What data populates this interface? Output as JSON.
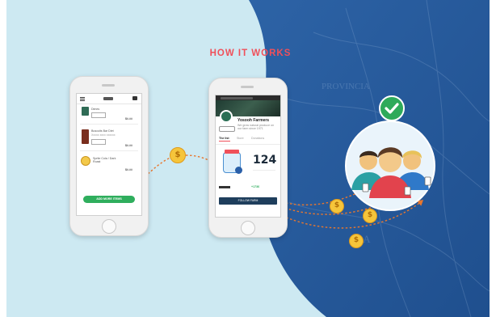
{
  "heading": "HOW IT WORKS",
  "colors": {
    "background_light": "#cde9f2",
    "background_dark": "#265a9b",
    "accent_red": "#f0505a",
    "cta_green": "#2fae5d",
    "coin_gold": "#f5c53b",
    "check_green": "#2eaa5a",
    "arrow_orange": "#e8772e"
  },
  "phone_left": {
    "cart_items": [
      {
        "title": "Dimes",
        "price": "$#.##"
      },
      {
        "title": "Buscuits Bar Diet",
        "subtitle": "Xxxxx xxxx xxxxxx",
        "price": "$#.##"
      },
      {
        "title": "Sprite Cola / Dark Roast",
        "price": "$#.##"
      }
    ],
    "cta_button": "ADD MORE ITEMS"
  },
  "phone_right": {
    "profile_name": "Yosooh Farmers",
    "profile_desc": "We grow natural produce on our farm since 1971",
    "tabs": [
      "The list",
      "Store",
      "Donations"
    ],
    "counter_value": "124",
    "stat_value": "+1736",
    "footer_button": "FOLLOW FARM"
  },
  "icons": {
    "coin_symbol": "$",
    "check": "checkmark-icon",
    "menu": "hamburger-icon",
    "cart": "cart-icon"
  }
}
